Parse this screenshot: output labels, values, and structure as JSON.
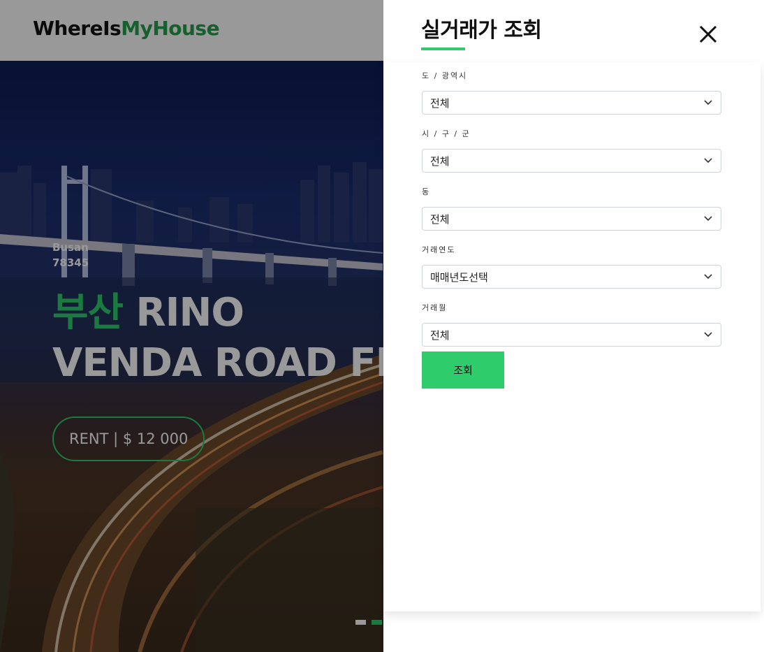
{
  "header": {
    "logo_part1": "WhereIs",
    "logo_part2": "MyHouse"
  },
  "hero": {
    "city_en": "Busan",
    "zip": "78345",
    "title_accent": "부산",
    "title_line1_rest": " RINO",
    "title_line2": "VENDA ROAD FIVE",
    "rent_label": "RENT | $ 12 000",
    "slider_active_index": 1
  },
  "panel": {
    "title": "실거래가 조회",
    "close_icon": "close-icon",
    "fields": [
      {
        "label": "도 / 광역시",
        "value": "전체"
      },
      {
        "label": "시 / 구 / 군",
        "value": "전체"
      },
      {
        "label": "동",
        "value": "전체"
      },
      {
        "label": "거래연도",
        "value": "매매년도선택"
      },
      {
        "label": "거래월",
        "value": "전체"
      }
    ],
    "submit_label": "조회"
  },
  "colors": {
    "accent": "#2ecc6a",
    "logo_accent": "#23a04a"
  }
}
